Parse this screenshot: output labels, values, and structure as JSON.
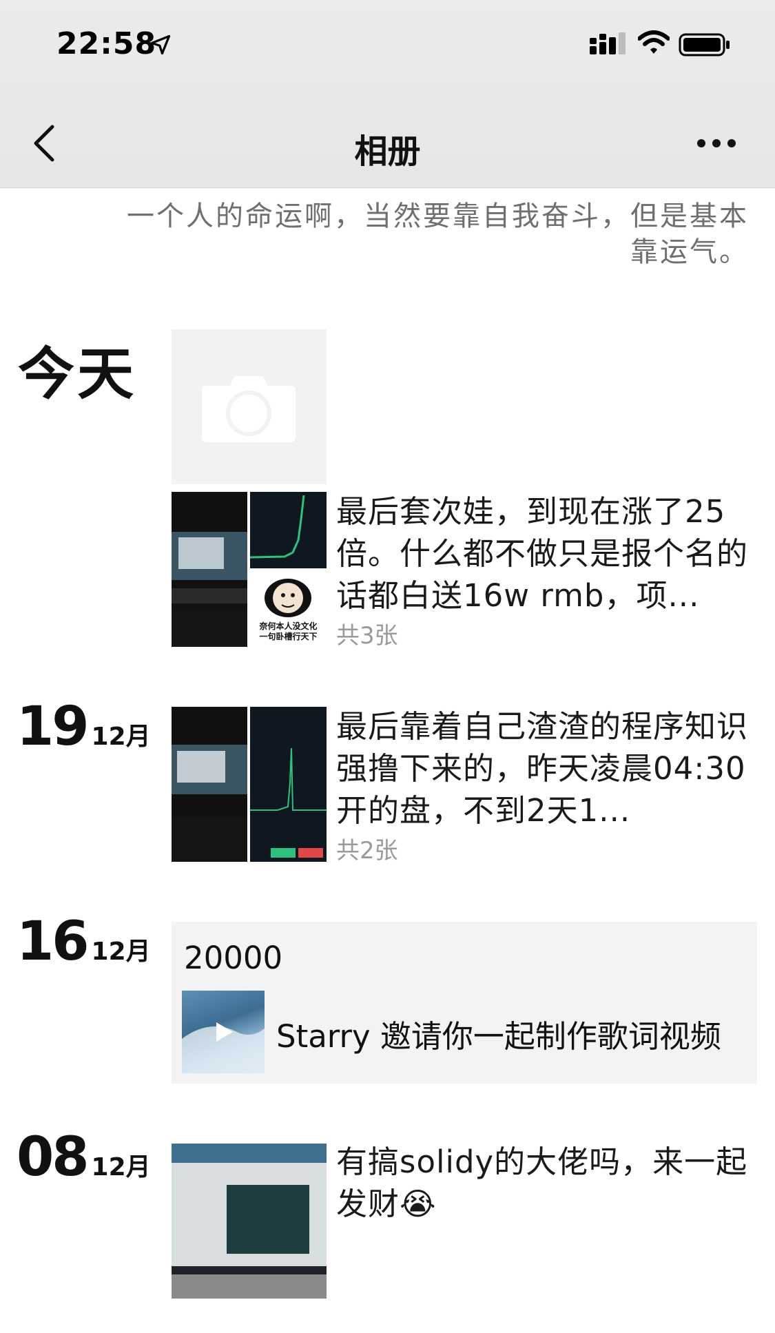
{
  "status_bar": {
    "time": "22:58"
  },
  "nav": {
    "title": "相册"
  },
  "signature": "一个人的命运啊，当然要靠自我奋斗，但是基本靠运气。",
  "posts": [
    {
      "date": "今天",
      "type": "camera"
    },
    {
      "text": "最后套次娃，到现在涨了25倍。什么都不做只是报个名的话都白送16w rmb，项...",
      "count": "共3张",
      "thumb_captions": [
        "奈何本人没文化",
        "一句卧槽行天下"
      ]
    },
    {
      "day": "19",
      "month": "12月",
      "text": "最后靠着自己渣渣的程序知识强撸下来的，昨天凌晨04:30开的盘，不到2天1...",
      "count": "共2张"
    },
    {
      "day": "16",
      "month": "12月",
      "share_title": "20000",
      "share_text": "Starry 邀请你一起制作歌词视频"
    },
    {
      "day": "08",
      "month": "12月",
      "text": "有搞solidy的大佬吗，来一起发财😭"
    }
  ]
}
